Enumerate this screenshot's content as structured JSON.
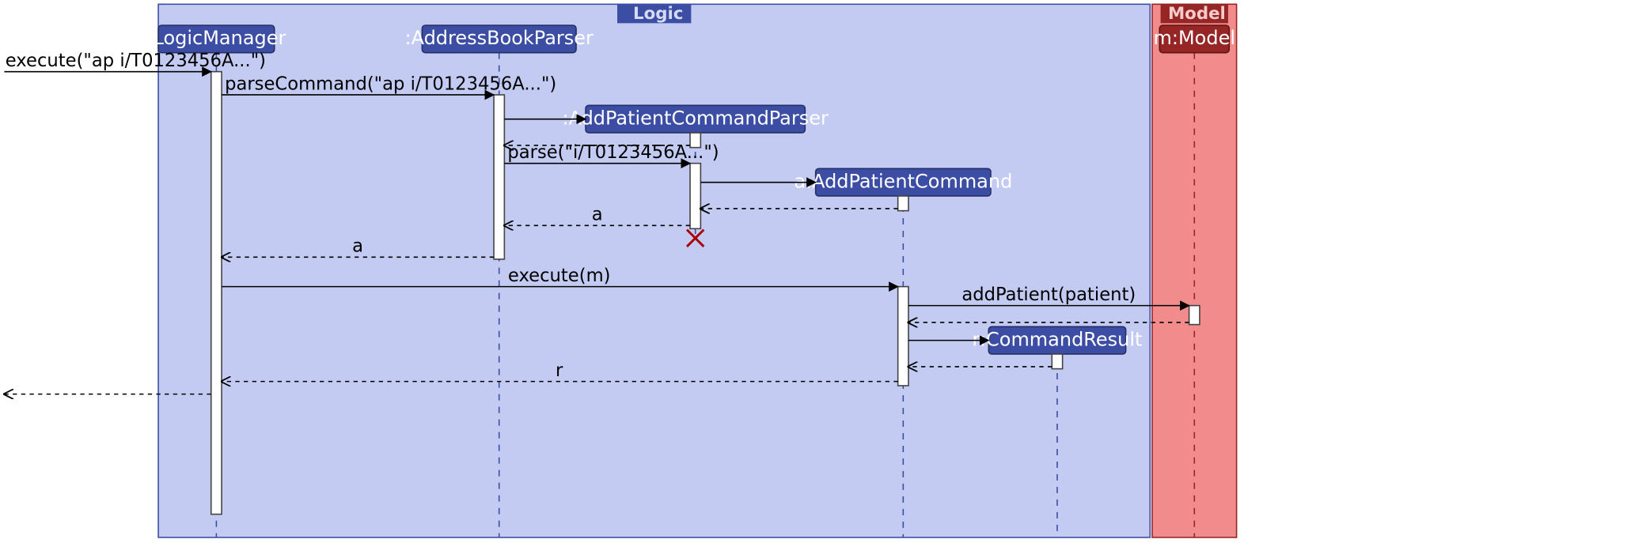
{
  "frames": {
    "logic": {
      "label": "Logic"
    },
    "model": {
      "label": "Model"
    }
  },
  "participants": {
    "logicManager": ":LogicManager",
    "addressBookParser": ":AddressBookParser",
    "addPatientCommandParser": ":AddPatientCommandParser",
    "addPatientCommand": "a:AddPatientCommand",
    "model": "m:Model",
    "commandResult": "r:CommandResult"
  },
  "messages": {
    "execute1": "execute(\"ap i/T0123456A...\")",
    "parseCommand": "parseCommand(\"ap i/T0123456A...\")",
    "parse": "parse(\"i/T0123456A...\")",
    "returnA1": "a",
    "returnA2": "a",
    "executeM": "execute(m)",
    "addPatient": "addPatient(patient)",
    "returnR": "r"
  }
}
